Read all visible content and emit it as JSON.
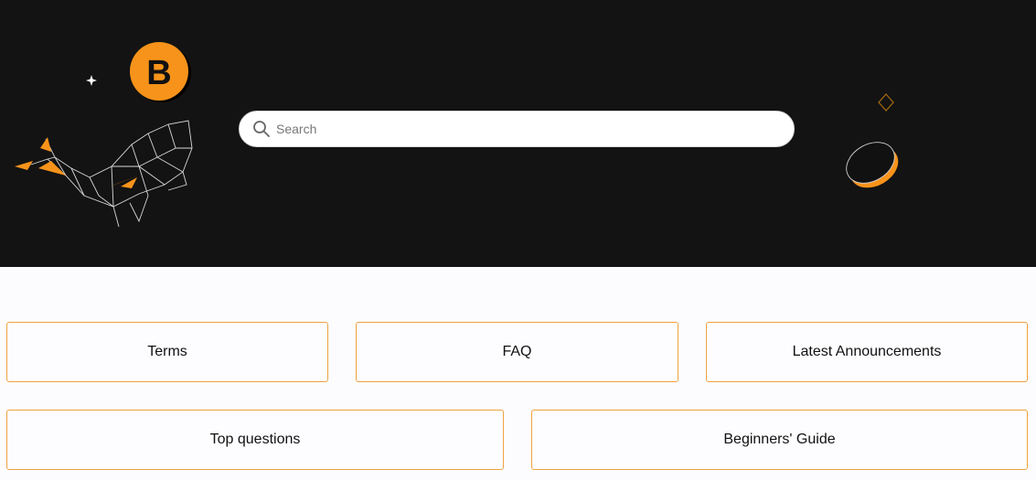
{
  "colors": {
    "hero_bg": "#131313",
    "accent": "#f7931a",
    "card_border": "#f0a240",
    "page_bg": "#fcfcff"
  },
  "search": {
    "placeholder": "Search",
    "value": "",
    "icon": "search-icon"
  },
  "logo": {
    "letter": "B",
    "icon": "brand-coin-logo"
  },
  "decorations": [
    "sparkle-icon",
    "geometric-whale-illustration",
    "diamond-outline-icon",
    "tilted-coin-illustration"
  ],
  "categories": [
    {
      "label": "Terms"
    },
    {
      "label": "FAQ"
    },
    {
      "label": "Latest Announcements"
    },
    {
      "label": "Top questions"
    },
    {
      "label": "Beginners' Guide"
    }
  ]
}
